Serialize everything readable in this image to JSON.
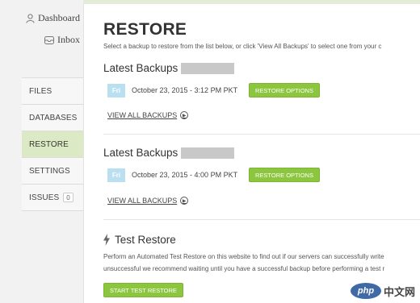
{
  "sidebar": {
    "top_links": [
      {
        "label": "Dashboard",
        "icon": "user-icon"
      },
      {
        "label": "Inbox",
        "icon": "inbox-icon"
      }
    ],
    "nav": [
      {
        "label": "FILES"
      },
      {
        "label": "DATABASES"
      },
      {
        "label": "RESTORE",
        "active": true
      },
      {
        "label": "SETTINGS"
      },
      {
        "label": "ISSUES",
        "badge": "0"
      }
    ]
  },
  "main": {
    "title": "RESTORE",
    "subtitle": "Select a backup to restore from the list below, or click 'View All Backups' to select one from your c",
    "sections": [
      {
        "title": "Latest Backups",
        "day": "Fri",
        "date": "October 23, 2015 - 3:12 PM PKT",
        "restore_label": "RESTORE OPTIONS",
        "view_all_label": "VIEW ALL BACKUPS"
      },
      {
        "title": "Latest Backups",
        "day": "Fri",
        "date": "October 23, 2015 - 4:00 PM PKT",
        "restore_label": "RESTORE OPTIONS",
        "view_all_label": "VIEW ALL BACKUPS"
      }
    ],
    "test_restore": {
      "title": "Test Restore",
      "desc_line1": "Perform an Automated Test Restore on this website to find out if our servers can successfully write",
      "desc_line2": "unsuccessful we recommend waiting until you have a successful backup before performing a test r",
      "button_label": "START TEST RESTORE"
    }
  },
  "watermark": {
    "logo": "php",
    "text": "中文网"
  },
  "colors": {
    "accent_green": "#8cc63f",
    "active_nav": "#dbe9c4",
    "day_badge": "#b9dff0"
  }
}
